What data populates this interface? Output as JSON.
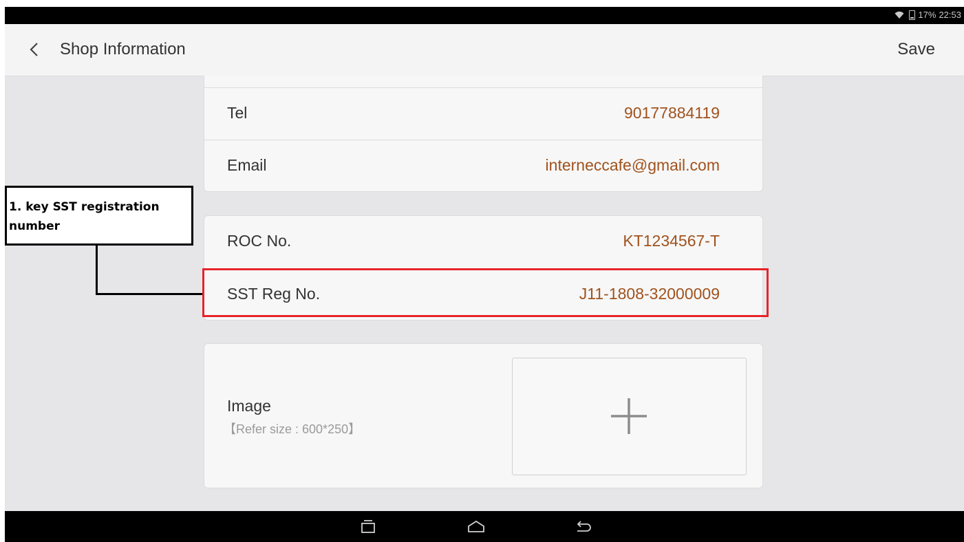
{
  "status_bar": {
    "battery": "17%",
    "time": "22:53"
  },
  "header": {
    "title": "Shop Information",
    "save_label": "Save"
  },
  "contact": {
    "tel_label": "Tel",
    "tel_value": "90177884119",
    "email_label": "Email",
    "email_value": "interneccafe@gmail.com"
  },
  "registration": {
    "roc_label": "ROC No.",
    "roc_value": "KT1234567-T",
    "sst_label": "SST Reg No.",
    "sst_value": "J11-1808-32000009"
  },
  "image": {
    "label": "Image",
    "hint": "【Refer size : 600*250】"
  },
  "annotation": {
    "text": "1. key SST registration number"
  },
  "icons": {
    "back": "chevron-left-icon",
    "plus": "plus-icon",
    "recent": "recent-apps-icon",
    "home": "home-icon",
    "nav_back": "back-arrow-icon",
    "wifi": "wifi-icon",
    "battery": "battery-icon"
  },
  "colors": {
    "value_text": "#a0521d",
    "highlight": "#e8232a",
    "background": "#e6e6e9"
  }
}
